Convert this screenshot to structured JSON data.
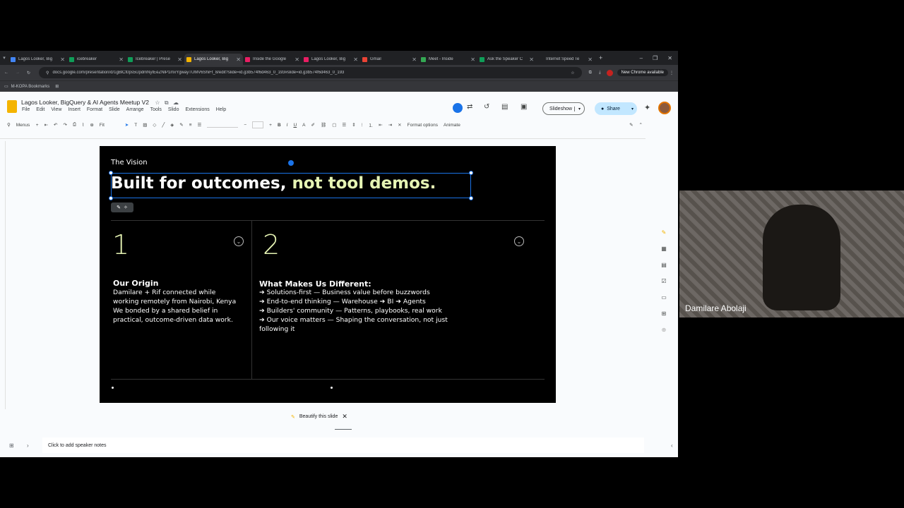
{
  "browser": {
    "tabs": [
      {
        "label": "Lagos Looker, Big",
        "color": "#4285f4"
      },
      {
        "label": "icebreaker",
        "color": "#0f9d58"
      },
      {
        "label": "Icebreaker | Prese",
        "color": "#0f9d58"
      },
      {
        "label": "Lagos Looker, Big",
        "color": "#f4b400",
        "active": true
      },
      {
        "label": "Inside the Google",
        "color": "#e91e63"
      },
      {
        "label": "Lagos Looker, Big",
        "color": "#e91e63"
      },
      {
        "label": "Gmail",
        "color": "#ea4335"
      },
      {
        "label": "Meet - Inside",
        "color": "#34a853"
      },
      {
        "label": "Ask the Speaker C",
        "color": "#0f9d58"
      },
      {
        "label": "Internet Speed Te",
        "color": "#202124"
      }
    ],
    "url": "docs.google.com/presentation/d/1gBlCt0ps5UpdmNyIEeZNlP1mxYgwayTUMV6ShiFt_8/edit?slide=id.g3b574f6d463_0_193#slide=id.g3b574f6d463_0_193",
    "update_label": "New Chrome available",
    "bookmarks_label": "M-KOPA Bookmarks"
  },
  "docs": {
    "title": "Lagos Looker, BigQuery & AI Agents Meetup V2",
    "menus": [
      "File",
      "Edit",
      "View",
      "Insert",
      "Format",
      "Slide",
      "Arrange",
      "Tools",
      "Slido",
      "Extensions",
      "Help"
    ],
    "slideshow_label": "Slideshow",
    "share_label": "Share",
    "toolbar": {
      "menus_label": "Menus",
      "zoom_label": "Fit",
      "format_options_label": "Format options",
      "animate_label": "Animate"
    },
    "beautify_label": "Beautify this slide",
    "speaker_notes_placeholder": "Click to add speaker notes"
  },
  "slide": {
    "eyebrow": "The Vision",
    "headline_part1": "Built for outcomes, ",
    "headline_part2": "not tool demos.",
    "col1": {
      "number": "1",
      "heading": "Our Origin",
      "lines": [
        "Damilare + Rif connected while",
        "working remotely from Nairobi, Kenya",
        "We bonded by a shared belief in",
        "practical, outcome-driven data work."
      ]
    },
    "col2": {
      "number": "2",
      "heading": "What Makes Us Different:",
      "lines": [
        "➔ Solutions-first — Business value before buzzwords",
        "➔ End-to-end thinking — Warehouse ➔ BI ➔ Agents",
        "➔ Builders' community — Patterns, playbooks, real work",
        "➔ Our voice matters — Shaping the conversation, not just",
        "following it"
      ]
    }
  },
  "camera": {
    "participant_name": "Damilare Abolaji"
  }
}
